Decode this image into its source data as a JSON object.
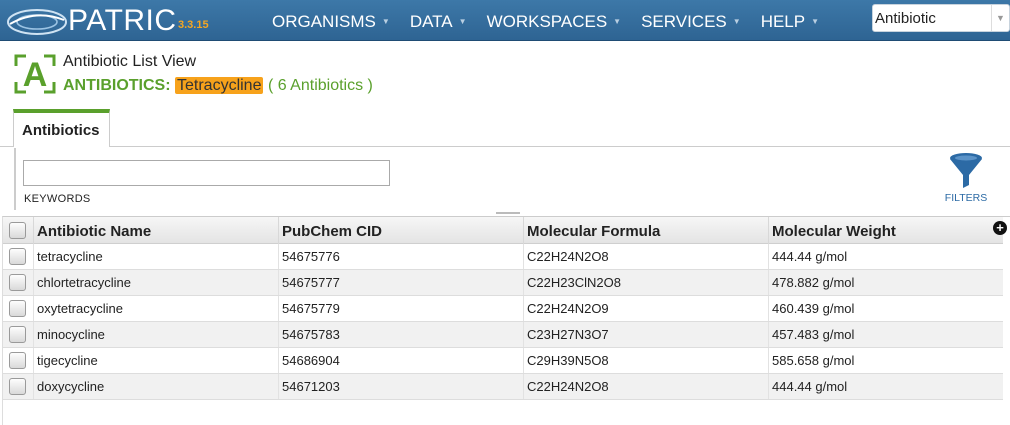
{
  "app": {
    "name": "PATRIC",
    "version": "3.3.15"
  },
  "nav": {
    "items": [
      {
        "label": "ORGANISMS"
      },
      {
        "label": "DATA"
      },
      {
        "label": "WORKSPACES"
      },
      {
        "label": "SERVICES"
      },
      {
        "label": "HELP"
      }
    ],
    "search_value": "Antibiotic"
  },
  "header": {
    "view_title": "Antibiotic List View",
    "section_label": "ANTIBIOTICS:",
    "highlight": "Tetracycline",
    "count": "( 6 Antibiotics )",
    "icon_letter": "A"
  },
  "tabs": [
    {
      "label": "Antibiotics"
    }
  ],
  "filter": {
    "keywords_value": "",
    "keywords_label": "KEYWORDS",
    "filters_label": "FILTERS"
  },
  "table": {
    "columns": [
      "Antibiotic Name",
      "PubChem CID",
      "Molecular Formula",
      "Molecular Weight"
    ],
    "rows": [
      {
        "name": "tetracycline",
        "cid": "54675776",
        "formula": "C22H24N2O8",
        "weight": "444.44 g/mol"
      },
      {
        "name": "chlortetracycline",
        "cid": "54675777",
        "formula": "C22H23ClN2O8",
        "weight": "478.882 g/mol"
      },
      {
        "name": "oxytetracycline",
        "cid": "54675779",
        "formula": "C22H24N2O9",
        "weight": "460.439 g/mol"
      },
      {
        "name": "minocycline",
        "cid": "54675783",
        "formula": "C23H27N3O7",
        "weight": "457.483 g/mol"
      },
      {
        "name": "tigecycline",
        "cid": "54686904",
        "formula": "C29H39N5O8",
        "weight": "585.658 g/mol"
      },
      {
        "name": "doxycycline",
        "cid": "54671203",
        "formula": "C22H24N2O8",
        "weight": "444.44 g/mol"
      }
    ]
  },
  "colors": {
    "nav_bg": "#3d78a8",
    "accent_green": "#5aa02c",
    "highlight_orange": "#f7a21b",
    "version_orange": "#f4a623",
    "link_blue": "#2c6aa5"
  },
  "icons": {
    "logo": "patric-logo-icon",
    "filter": "funnel-icon",
    "add_column": "plus-circle-icon",
    "dropdown": "chevron-down-icon"
  }
}
